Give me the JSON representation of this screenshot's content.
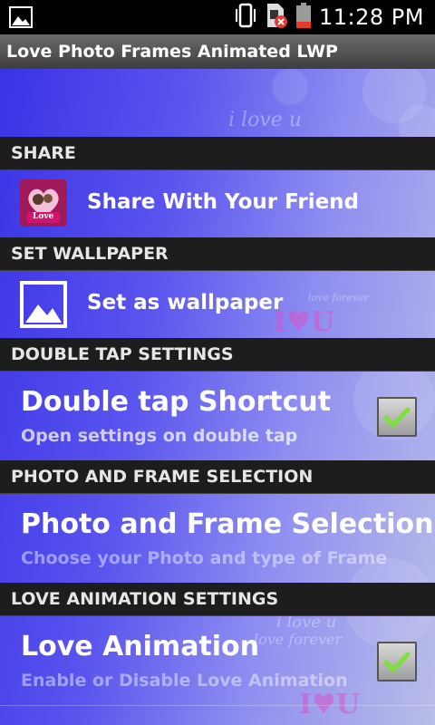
{
  "status_bar": {
    "time": "11:28 PM",
    "icons": [
      "image-icon",
      "vibrate-icon",
      "no-sim-icon",
      "battery-icon"
    ]
  },
  "app": {
    "title": "Love Photo Frames Animated LWP"
  },
  "decor": {
    "script1": "i love u",
    "script2": "love forever",
    "script3": "love forever",
    "script4": "i love u",
    "iu": "I♥U"
  },
  "sections": {
    "share": {
      "header": "SHARE",
      "label": "Share With Your Friend",
      "badge": "Love"
    },
    "wallpaper": {
      "header": "SET WALLPAPER",
      "label": "Set as wallpaper"
    },
    "double_tap": {
      "header": "DOUBLE TAP SETTINGS",
      "title": "Double tap Shortcut",
      "summary": "Open settings on double tap",
      "checked": true
    },
    "photo": {
      "header": "PHOTO AND FRAME SELECTION",
      "title": "Photo and Frame Selection",
      "summary": "Choose your Photo and type of Frame"
    },
    "animation": {
      "header": "LOVE ANIMATION SETTINGS",
      "title": "Love Animation",
      "summary": "Enable or Disable Love Animation",
      "checked": true
    }
  },
  "colors": {
    "accent": "#3a33e6",
    "check": "#7de03c",
    "header_bg": "#1d1d1d"
  }
}
